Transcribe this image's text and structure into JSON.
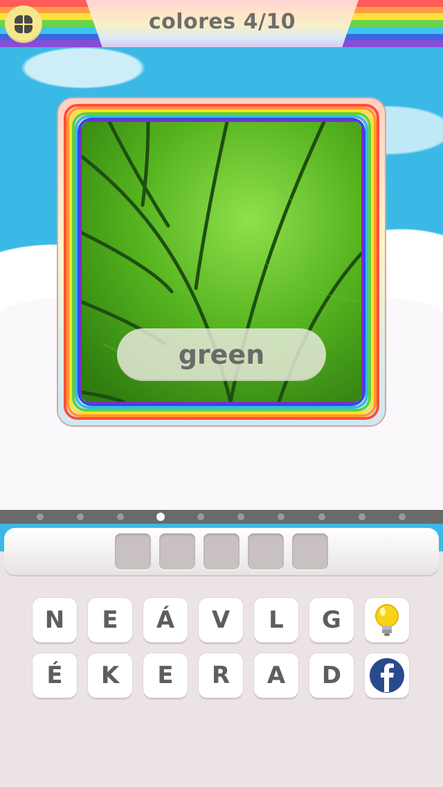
{
  "header": {
    "title": "colores 4/10",
    "menu_icon": "grid-menu-icon"
  },
  "puzzle": {
    "image_subject": "green leaf",
    "answer_hint": "green"
  },
  "progress": {
    "total_steps": 10,
    "current_step": 4
  },
  "answer": {
    "slot_count": 5,
    "letters": [
      "",
      "",
      "",
      "",
      ""
    ]
  },
  "keyboard": {
    "row1": [
      "N",
      "E",
      "Á",
      "V",
      "L",
      "G"
    ],
    "row2": [
      "É",
      "K",
      "E",
      "R",
      "A",
      "D"
    ],
    "hint_icon": "lightbulb-icon",
    "share_icon": "facebook-icon"
  },
  "colors": {
    "sky": "#3bb9e6",
    "key_text": "#5e5e5e",
    "slot": "#c9c1c1",
    "facebook": "#2a4a8e",
    "bulb": "#f7d417"
  }
}
